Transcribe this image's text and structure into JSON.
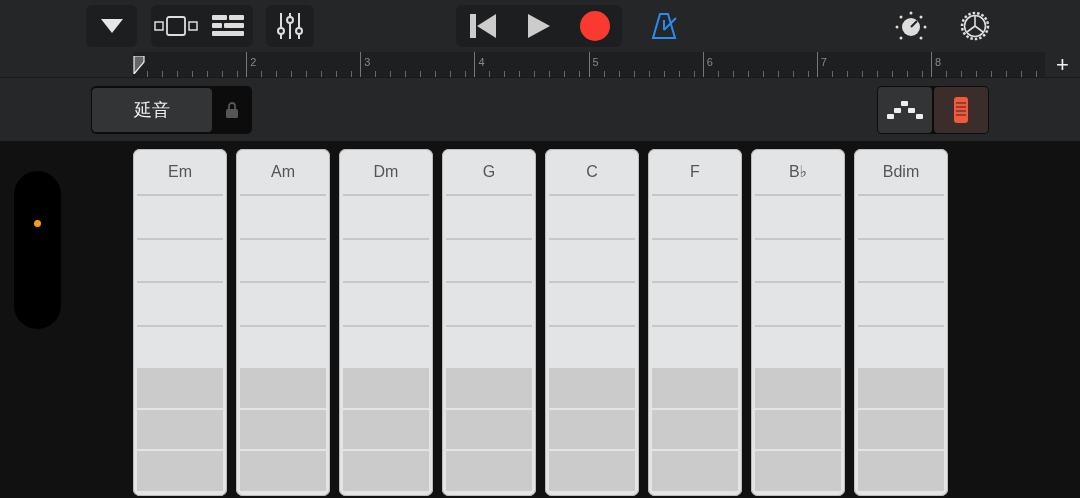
{
  "toolbar": {
    "metronome": {
      "on": true
    }
  },
  "ruler": {
    "bars": [
      "2",
      "3",
      "4",
      "5",
      "6",
      "7",
      "8"
    ],
    "add_label": "+"
  },
  "controls": {
    "sustain_label": "延音",
    "locked": true,
    "modes": [
      {
        "kind": "arpeggio",
        "selected": false
      },
      {
        "kind": "strips",
        "selected": true
      }
    ]
  },
  "chords": [
    {
      "label": "Em"
    },
    {
      "label": "Am"
    },
    {
      "label": "Dm"
    },
    {
      "label": "G"
    },
    {
      "label": "C"
    },
    {
      "label": "F"
    },
    {
      "label": "B♭"
    },
    {
      "label": "Bdim"
    }
  ]
}
